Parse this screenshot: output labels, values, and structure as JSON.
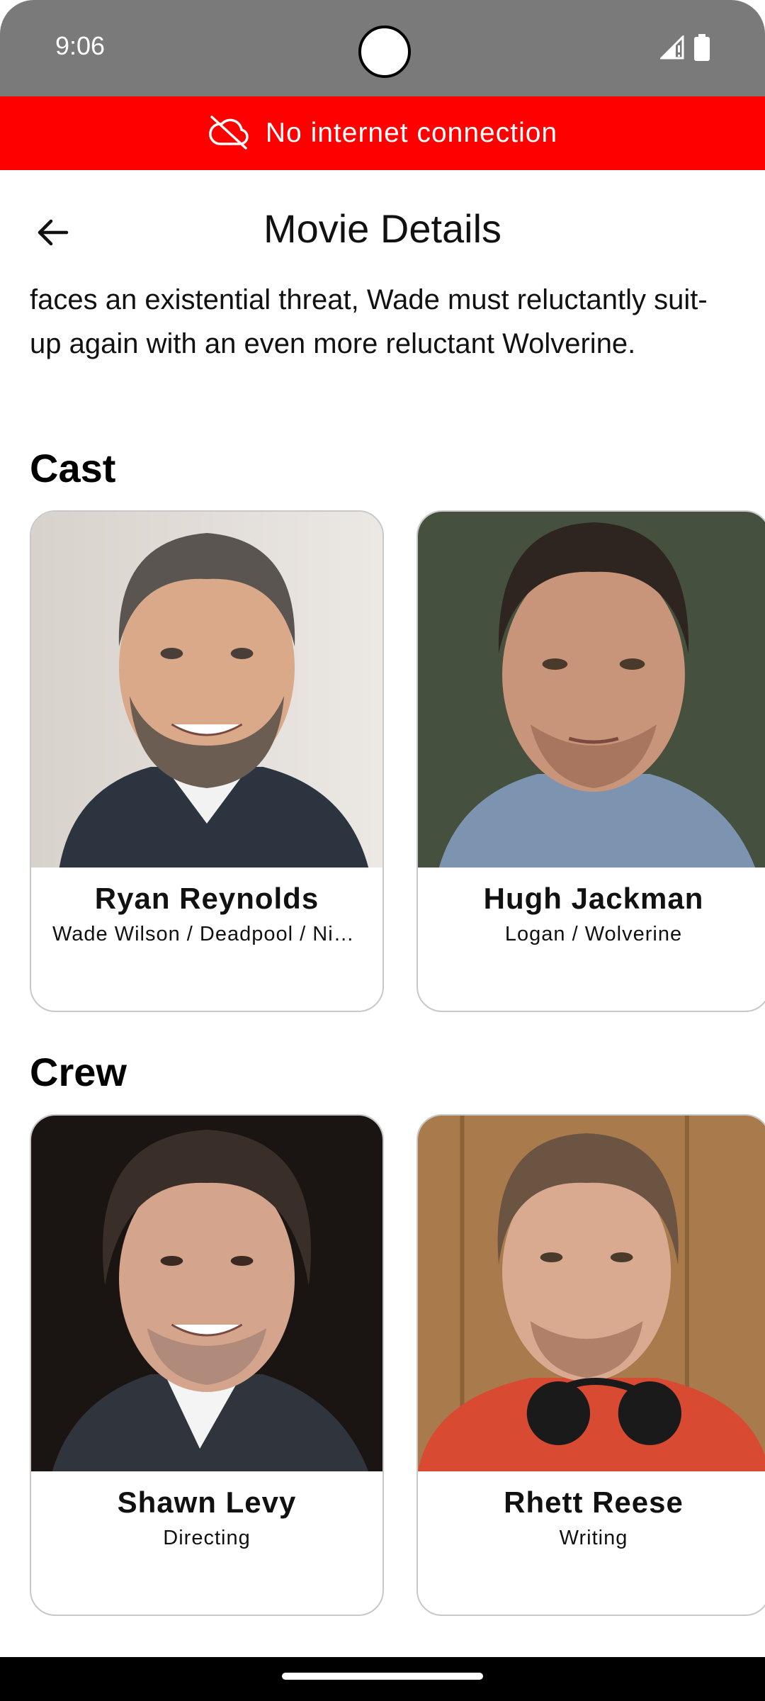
{
  "status_bar": {
    "time": "9:06"
  },
  "banner": {
    "text": "No internet connection",
    "icon": "cloud-off-icon",
    "color": "#ff0000"
  },
  "app_bar": {
    "title": "Movie Details",
    "back_icon": "arrow-left-icon"
  },
  "overview": {
    "text": "faces an existential threat, Wade must reluctantly suit-up again with an even more reluctant Wolverine."
  },
  "cast": {
    "heading": "Cast",
    "items": [
      {
        "name": "Ryan Reynolds",
        "role": "Wade Wilson / Deadpool / Nicepool"
      },
      {
        "name": "Hugh Jackman",
        "role": "Logan / Wolverine"
      }
    ]
  },
  "crew": {
    "heading": "Crew",
    "items": [
      {
        "name": "Shawn Levy",
        "role": "Directing"
      },
      {
        "name": "Rhett Reese",
        "role": "Writing"
      }
    ]
  }
}
